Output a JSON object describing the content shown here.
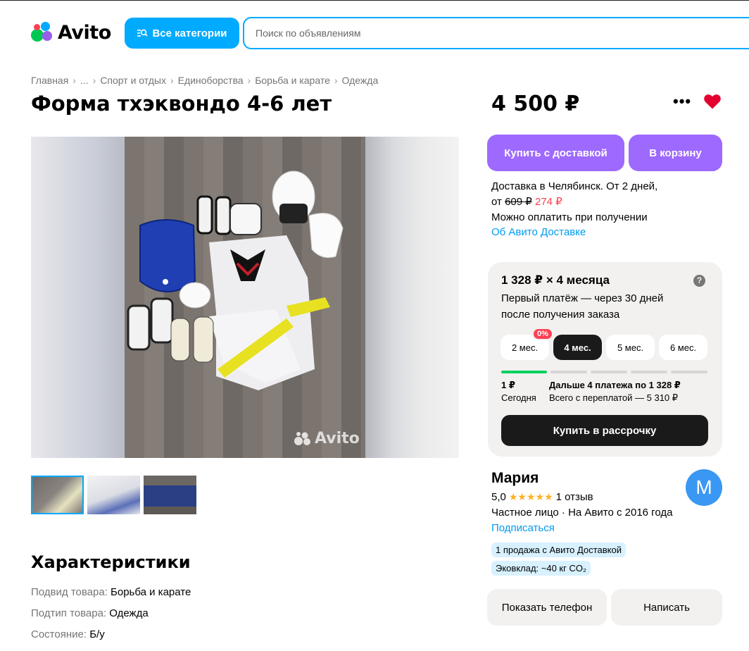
{
  "header": {
    "logo_text": "Avito",
    "categories_button": "Все категории",
    "search_placeholder": "Поиск по объявлениям"
  },
  "breadcrumbs": [
    "Главная",
    "...",
    "Спорт и отдых",
    "Единоборства",
    "Борьба и карате",
    "Одежда"
  ],
  "listing": {
    "title": "Форма тхэквондо 4-6 лет",
    "price": "4 500 ₽",
    "watermark": "Avito"
  },
  "characteristics": {
    "heading": "Характеристики",
    "items": [
      {
        "key": "Подвид товара:",
        "value": "Борьба и карате"
      },
      {
        "key": "Подтип товара:",
        "value": "Одежда"
      },
      {
        "key": "Состояние:",
        "value": "Б/у"
      }
    ]
  },
  "actions": {
    "buy_delivery": "Купить с доставкой",
    "to_cart": "В корзину",
    "more": "•••"
  },
  "delivery": {
    "line1": "Доставка в Челябинск. От 2 дней,",
    "from": "от",
    "old_price": "609 ₽",
    "new_price": "274 ₽",
    "pay_on_receipt": "Можно оплатить при получении",
    "about_link": "Об Авито Доставке"
  },
  "installment": {
    "lead": "1 328 ₽ × 4 месяца",
    "help": "?",
    "first_payment_line1": "Первый платёж — через 30 дней",
    "first_payment_line2": "после получения заказа",
    "badge": "0%",
    "months": [
      "2 мес.",
      "4 мес.",
      "5 мес.",
      "6 мес."
    ],
    "selected_month_index": 1,
    "today_amount": "1 ₽",
    "today_label": "Сегодня",
    "next_payments": "Дальше 4 платежа по 1 328 ₽",
    "total": "Всего с переплатой — 5 310 ₽",
    "buy_button": "Купить в рассрочку"
  },
  "seller": {
    "name": "Мария",
    "avatar_letter": "М",
    "rating": "5,0",
    "stars": "★★★★★",
    "reviews": "1 отзыв",
    "type": "Частное лицо · На Авито с 2016 года",
    "subscribe": "Подписаться",
    "chip_sales": "1 продажа с Авито Доставкой",
    "chip_eco": "Эковклад: ~40 кг CO₂"
  },
  "contact": {
    "show_phone": "Показать телефон",
    "write": "Написать"
  },
  "colors": {
    "accent_blue": "#00aaff",
    "purple": "#9e69ff",
    "red": "#ff4053",
    "green": "#02d15c"
  }
}
